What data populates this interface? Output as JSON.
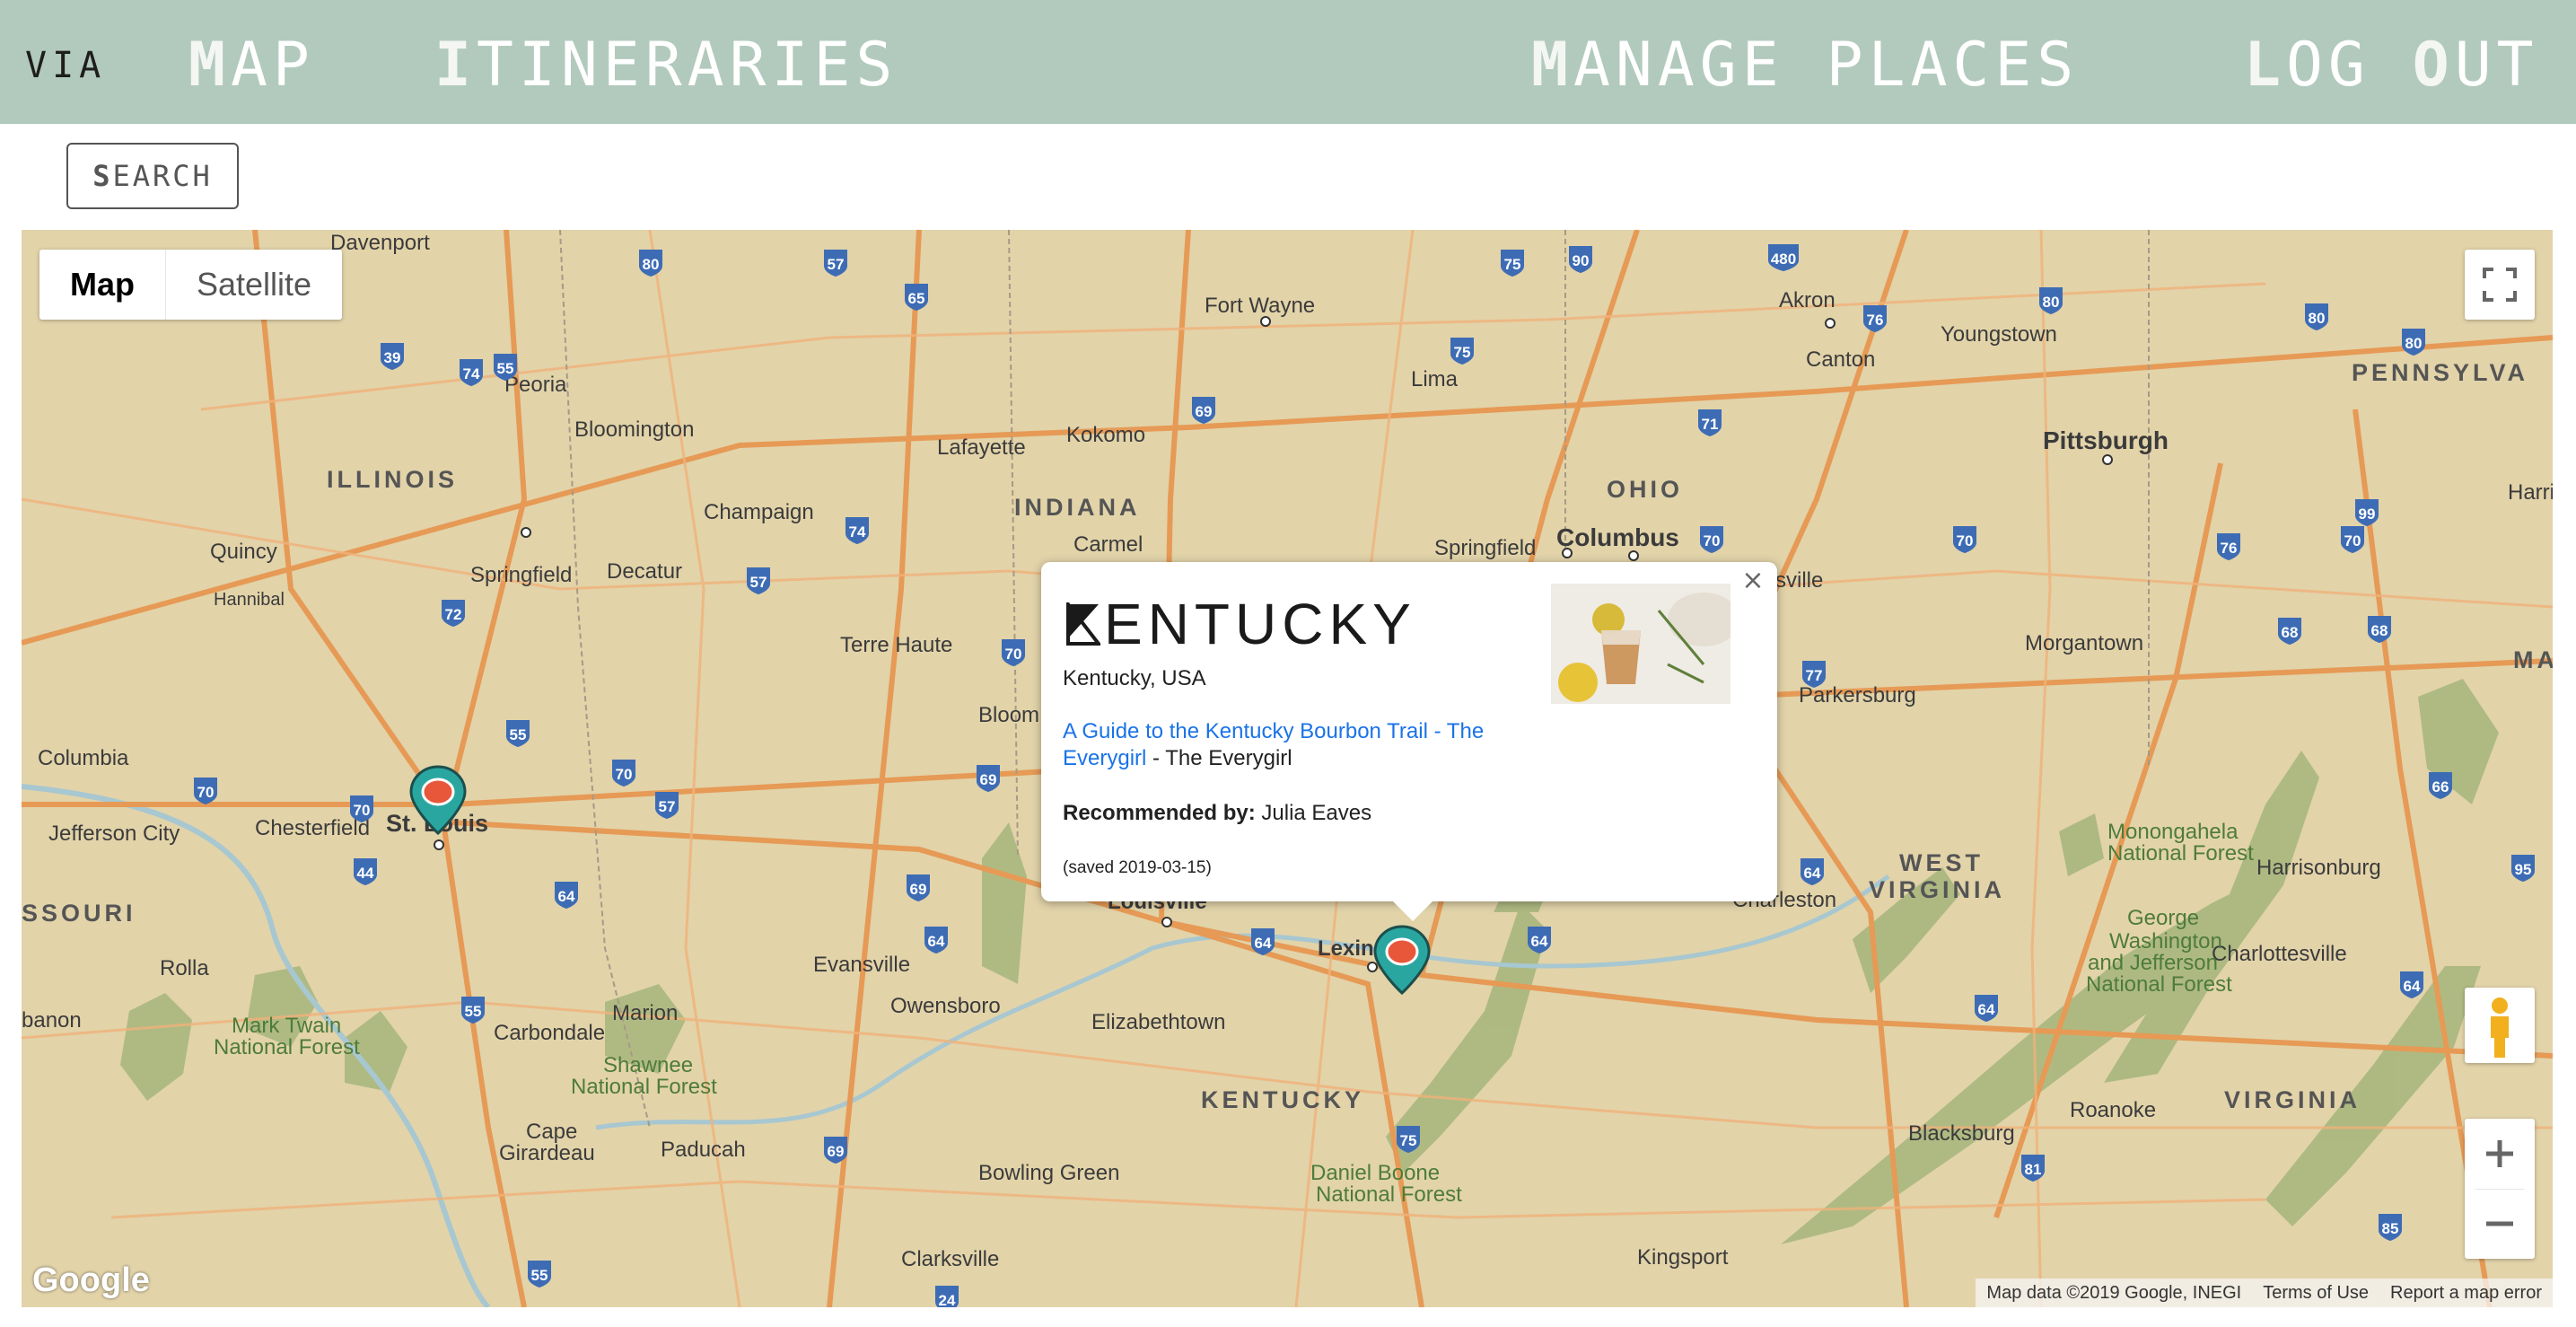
{
  "nav": {
    "logo": "VIA",
    "map": {
      "lead": "M",
      "rest": "AP"
    },
    "itineraries": {
      "lead": "I",
      "rest": "TINERARIES"
    },
    "manage_places": {
      "lead": "M",
      "rest": "ANAGE PLACES"
    },
    "log_out": {
      "lead": "L",
      "mid": "OG ",
      "lead2": "O",
      "rest": "UT"
    }
  },
  "search": {
    "lead": "S",
    "rest": "EARCH"
  },
  "map": {
    "type_buttons": [
      "Map",
      "Satellite"
    ],
    "active_type": "Map",
    "google_logo": "Google",
    "attribution": [
      "Map data ©2019 Google, INEGI",
      "Terms of Use",
      "Report a map error"
    ],
    "labels": {
      "states": [
        "ILLINOIS",
        "INDIANA",
        "OHIO",
        "PENNSYLVA",
        "KENTUCKY",
        "WEST",
        "VIRGINIA",
        "VIRGINIA",
        "SSOURI",
        "MA"
      ],
      "cities": [
        "Davenport",
        "Peoria",
        "Bloomington",
        "Champaign",
        "Quincy",
        "Springfield",
        "Decatur",
        "Hannibal",
        "Columbia",
        "Jefferson City",
        "Chesterfield",
        "St. Louis",
        "Rolla",
        "Carbondale",
        "Marion",
        "Cape Girardeau",
        "Paducah",
        "Fort Wayne",
        "Lafayette",
        "Kokomo",
        "Carmel",
        "Terre Haute",
        "Bloom",
        "Evansville",
        "Owensboro",
        "Louisville",
        "Elizabethtown",
        "Lexington",
        "Bowling Green",
        "Clarksville",
        "Lima",
        "Springfield",
        "Columbus",
        "Akron",
        "Canton",
        "Youngstown",
        "Pittsburgh",
        "Morgantown",
        "Parkersburg",
        "Charleston",
        "Harrisonburg",
        "Charlottesville",
        "Roanoke",
        "Blacksburg",
        "Kingsport",
        "Harri",
        "banon",
        "sville"
      ],
      "forests": [
        "Mark Twain National Forest",
        "Shawnee National Forest",
        "Daniel Boone National Forest",
        "Monongahela National Forest",
        "George Washington and Jefferson National Forest"
      ]
    },
    "markers": [
      "st-louis-marker",
      "lexington-marker"
    ]
  },
  "info_window": {
    "logo_text": "ENTUCKY",
    "address": "Kentucky, USA",
    "link_text": "A Guide to the Kentucky Bourbon Trail - The Everygirl",
    "link_suffix": " - The Everygirl",
    "recommended_label": "Recommended by:",
    "recommended_by": " Julia Eaves",
    "saved": "(saved 2019-03-15)",
    "close": "×"
  }
}
